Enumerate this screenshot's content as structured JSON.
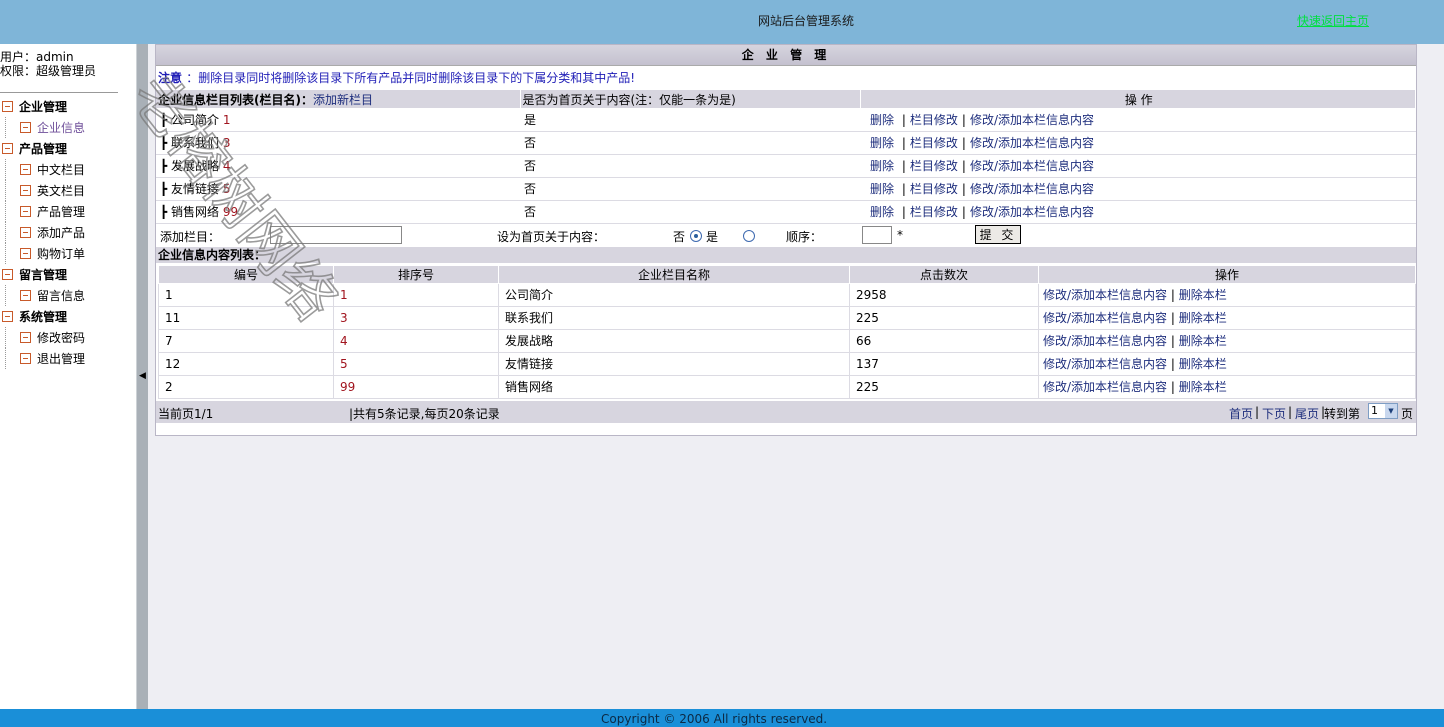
{
  "header": {
    "title": "网站后台管理系统",
    "home_link": "快速返回主页"
  },
  "user": {
    "name_line": "用户：admin",
    "role_line": "权限：超级管理员"
  },
  "menu": {
    "groups": [
      {
        "label": "企业管理",
        "items": [
          "企业信息"
        ]
      },
      {
        "label": "产品管理",
        "items": [
          "中文栏目",
          "英文栏目",
          "产品管理",
          "添加产品",
          "购物订单"
        ]
      },
      {
        "label": "留言管理",
        "items": [
          "留言信息"
        ]
      },
      {
        "label": "系统管理",
        "items": [
          "修改密码",
          "退出管理"
        ]
      }
    ]
  },
  "panel": {
    "title": "企 业 管 理",
    "notice_label": "注意",
    "notice_text": "：删除目录同时将删除该目录下所有产品并同时删除该目录下的下属分类和其中产品!",
    "cat_head": {
      "col1": "企业信息栏目列表(栏目名)：",
      "add_link": "添加新栏目",
      "col2": "是否为首页关于内容(注：仅能一条为是)",
      "col3": "操 作"
    },
    "cat_rows": [
      {
        "name": "公司简介",
        "order": "1",
        "is_home": "是"
      },
      {
        "name": "联系我们",
        "order": "3",
        "is_home": "否"
      },
      {
        "name": "发展战略",
        "order": "4",
        "is_home": "否"
      },
      {
        "name": "友情链接",
        "order": "5",
        "is_home": "否"
      },
      {
        "name": "销售网络",
        "order": "99",
        "is_home": "否"
      }
    ],
    "ops": {
      "delete": "删除",
      "edit": "栏目修改",
      "edit_content": "修改/添加本栏信息内容"
    },
    "add": {
      "label": "添加栏目：",
      "home_label": "设为首页关于内容：",
      "no": "否",
      "yes": "是",
      "order_label": "顺序：",
      "required": "*",
      "submit": "提 交"
    },
    "list_title": "企业信息内容列表：",
    "list_head": [
      "编号",
      "排序号",
      "企业栏目名称",
      "点击数次",
      "操作"
    ],
    "list_rows": [
      {
        "id": "1",
        "order": "1",
        "name": "公司简介",
        "clicks": "2958"
      },
      {
        "id": "11",
        "order": "3",
        "name": "联系我们",
        "clicks": "225"
      },
      {
        "id": "7",
        "order": "4",
        "name": "发展战略",
        "clicks": "66"
      },
      {
        "id": "12",
        "order": "5",
        "name": "友情链接",
        "clicks": "137"
      },
      {
        "id": "2",
        "order": "99",
        "name": "销售网络",
        "clicks": "225"
      }
    ],
    "list_ops": {
      "edit": "修改/添加本栏信息内容",
      "delete": "删除本栏"
    },
    "footer": {
      "current": "当前页1/1",
      "summary": "|共有5条记录,每页20条记录",
      "first": "首页",
      "next": "下页",
      "last": "尾页",
      "goto": "转到第",
      "page_value": "1",
      "page_suffix": "页"
    }
  },
  "watermark": "老榕树网络",
  "copyright": "Copyright © 2006 All rights reserved."
}
